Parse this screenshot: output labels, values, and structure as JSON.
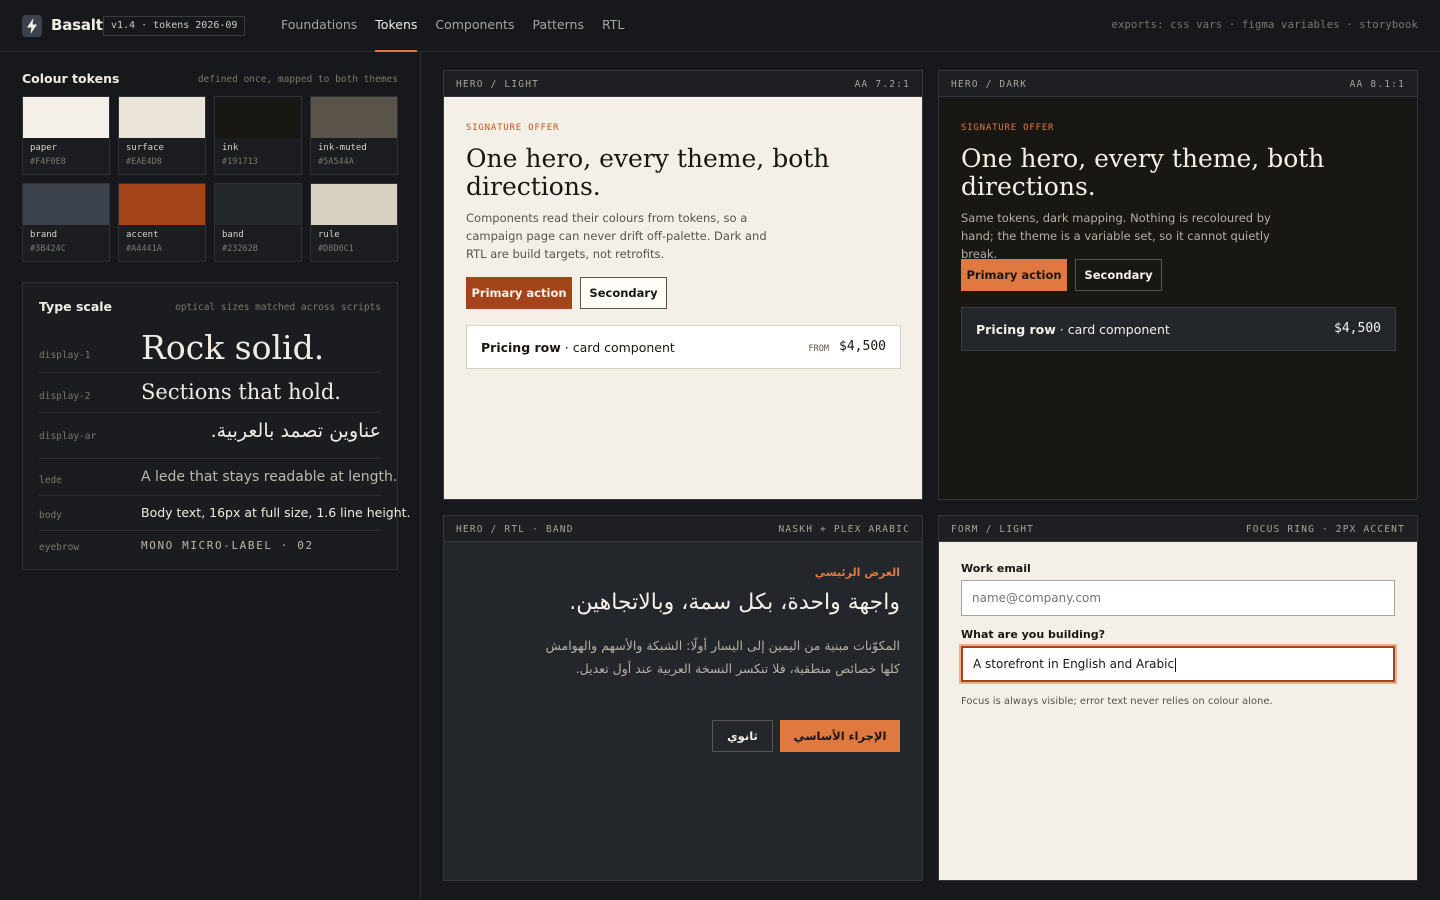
{
  "header": {
    "brand": "Basalt",
    "version": "v1.4 · tokens 2026-09",
    "nav": [
      "Foundations",
      "Tokens",
      "Components",
      "Patterns",
      "RTL"
    ],
    "active_nav": "Tokens",
    "exports": "exports: css vars · figma variables · storybook"
  },
  "colour_tokens": {
    "title": "Colour tokens",
    "subtitle": "defined once, mapped to both themes",
    "swatches": [
      {
        "name": "paper",
        "hex": "#F4F0E8"
      },
      {
        "name": "surface",
        "hex": "#EAE4D8"
      },
      {
        "name": "ink",
        "hex": "#191713"
      },
      {
        "name": "ink-muted",
        "hex": "#5A544A"
      },
      {
        "name": "brand",
        "hex": "#3B424C"
      },
      {
        "name": "accent",
        "hex": "#A4441A"
      },
      {
        "name": "band",
        "hex": "#23262B"
      },
      {
        "name": "rule",
        "hex": "#D8D0C1"
      }
    ]
  },
  "type_scale": {
    "title": "Type scale",
    "subtitle": "optical sizes matched across scripts",
    "rows": [
      {
        "label": "display-1",
        "sample": "Rock solid."
      },
      {
        "label": "display-2",
        "sample": "Sections that hold."
      },
      {
        "label": "display-ar",
        "sample": "عناوين تصمد بالعربية."
      },
      {
        "label": "lede",
        "sample": "A lede that stays readable at length."
      },
      {
        "label": "body",
        "sample": "Body text, 16px at full size, 1.6 line height."
      },
      {
        "label": "eyebrow",
        "sample": "MONO MICRO-LABEL · 02"
      }
    ]
  },
  "hero_light": {
    "header_left": "HERO / LIGHT",
    "header_right": "AA 7.2:1",
    "eyebrow": "SIGNATURE OFFER",
    "title": "One hero, every theme, both directions.",
    "text": "Components read their colours from tokens, so a campaign page can never drift off-palette. Dark and RTL are build targets, not retrofits.",
    "primary": "Primary action",
    "secondary": "Secondary",
    "pricing_label": "Pricing row",
    "pricing_sub": "· card component",
    "from": "FROM",
    "price": "$4,500"
  },
  "hero_dark": {
    "header_left": "HERO / DARK",
    "header_right": "AA 8.1:1",
    "eyebrow": "SIGNATURE OFFER",
    "title": "One hero, every theme, both directions.",
    "text": "Same tokens, dark mapping. Nothing is recoloured by hand; the theme is a variable set, so it cannot quietly break.",
    "primary": "Primary action",
    "secondary": "Secondary",
    "pricing_label": "Pricing row",
    "pricing_sub": "· card component",
    "price": "$4,500"
  },
  "hero_rtl": {
    "header_left": "HERO / RTL · BAND",
    "header_right": "NASKH + PLEX ARABIC",
    "eyebrow": "العرض الرئيسي",
    "title": "واجهة واحدة، بكل سمة، وبالاتجاهين.",
    "text": "المكوّنات مبنية من اليمين إلى اليسار أولًا: الشبكة والأسهم والهوامش كلها خصائص منطقية، فلا تنكسر النسخة العربية عند أول تعديل.",
    "primary": "الإجراء الأساسي",
    "secondary": "ثانوي"
  },
  "form_light": {
    "header_left": "FORM / LIGHT",
    "header_right": "FOCUS RING · 2PX ACCENT",
    "email_label": "Work email",
    "email_placeholder": "name@company.com",
    "build_label": "What are you building?",
    "build_value": "A storefront in English and Arabic",
    "helper": "Focus is always visible; error text never relies on colour alone."
  },
  "colors": {
    "accent": "#E0793F",
    "accent_dark": "#A4441A"
  }
}
